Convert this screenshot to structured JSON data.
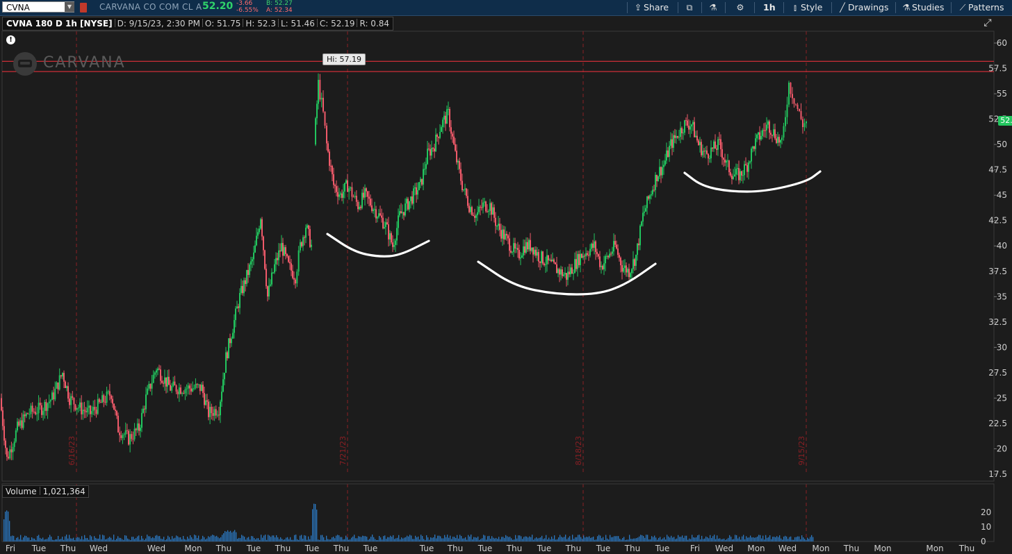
{
  "toolbar": {
    "symbol": "CVNA",
    "company": "CARVANA CO COM CL A",
    "last_price": "52.20",
    "net_change": "-3.66",
    "pct_change": "-6.55%",
    "bid": "B: 52.27",
    "ask": "A: 52.34",
    "share_label": "Share",
    "timeframe_label": "1h",
    "style_label": "Style",
    "drawings_label": "Drawings",
    "studies_label": "Studies",
    "patterns_label": "Patterns"
  },
  "chart_header": {
    "title": "CVNA 180 D 1h [NYSE]",
    "date": "D: 9/15/23, 2:30 PM",
    "open": "O: 51.75",
    "high": "H: 52.3",
    "low": "L: 51.46",
    "close": "C: 52.19",
    "range": "R: 0.84"
  },
  "logo_text": "CARVANA",
  "hi_label": "Hi: 57.19",
  "price_badge": "52.19",
  "volume_header": {
    "label": "Volume",
    "value": "1,021,364"
  },
  "colors": {
    "up": "#22c55e",
    "down": "#f05a6a",
    "resistance": "#e0303a",
    "annotation": "#ffffff",
    "background": "#1c1c1c"
  },
  "chart_data": {
    "type": "candlestick",
    "ylim": [
      17.5,
      60
    ],
    "y_ticks": [
      "60",
      "57.5",
      "55",
      "52.5",
      "50",
      "47.5",
      "45",
      "42.5",
      "40",
      "37.5",
      "35",
      "32.5",
      "30",
      "27.5",
      "25",
      "22.5",
      "20",
      "17.5"
    ],
    "x_tick_labels": [
      "Fri",
      "Tue",
      "Thu",
      "Wed",
      "Wed",
      "Mon",
      "Thu",
      "Tue",
      "Thu",
      "Tue",
      "Thu",
      "Tue",
      "Tue",
      "Thu",
      "Tue",
      "Thu",
      "Tue",
      "Thu",
      "Tue",
      "Thu",
      "Tue",
      "Fri",
      "Wed",
      "Mon",
      "Wed",
      "Mon",
      "Thu",
      "Mon",
      "Mon",
      "Thu"
    ],
    "period_markers": [
      "6/16/23",
      "7/21/23",
      "8/18/23",
      "9/15/23"
    ],
    "resistance_levels": [
      58.2,
      57.19
    ],
    "price_path": [
      [
        0,
        25
      ],
      [
        10,
        19
      ],
      [
        25,
        22
      ],
      [
        40,
        23.5
      ],
      [
        60,
        24
      ],
      [
        75,
        25
      ],
      [
        90,
        27.5
      ],
      [
        100,
        25
      ],
      [
        115,
        24
      ],
      [
        130,
        23.5
      ],
      [
        145,
        24.5
      ],
      [
        160,
        25.5
      ],
      [
        170,
        22
      ],
      [
        185,
        21
      ],
      [
        200,
        22
      ],
      [
        210,
        25
      ],
      [
        225,
        28
      ],
      [
        235,
        27
      ],
      [
        245,
        26
      ],
      [
        260,
        26
      ],
      [
        275,
        26
      ],
      [
        290,
        26
      ],
      [
        300,
        23.5
      ],
      [
        315,
        24
      ],
      [
        325,
        29
      ],
      [
        335,
        32
      ],
      [
        345,
        35
      ],
      [
        355,
        37
      ],
      [
        365,
        39
      ],
      [
        375,
        43
      ],
      [
        385,
        35
      ],
      [
        395,
        38
      ],
      [
        405,
        40
      ],
      [
        415,
        38
      ],
      [
        425,
        37
      ],
      [
        432,
        40
      ],
      [
        440,
        42
      ],
      [
        448,
        40
      ]
    ],
    "price_path_2": [
      [
        452,
        50
      ],
      [
        458,
        56
      ],
      [
        465,
        53
      ],
      [
        470,
        50
      ],
      [
        480,
        46
      ],
      [
        490,
        45
      ],
      [
        500,
        46
      ],
      [
        515,
        44
      ],
      [
        525,
        45
      ],
      [
        535,
        44
      ],
      [
        545,
        43
      ],
      [
        555,
        42
      ],
      [
        565,
        40
      ],
      [
        575,
        43
      ],
      [
        585,
        44
      ],
      [
        595,
        45
      ],
      [
        605,
        46
      ],
      [
        615,
        49
      ],
      [
        625,
        50
      ],
      [
        635,
        52
      ],
      [
        645,
        53
      ],
      [
        655,
        49
      ],
      [
        665,
        46
      ],
      [
        675,
        44
      ],
      [
        685,
        43
      ],
      [
        695,
        44
      ],
      [
        705,
        44
      ],
      [
        715,
        42
      ],
      [
        725,
        41
      ],
      [
        735,
        40
      ],
      [
        745,
        39
      ],
      [
        755,
        40
      ],
      [
        765,
        40
      ],
      [
        775,
        39
      ],
      [
        785,
        38.5
      ],
      [
        795,
        38
      ],
      [
        805,
        37.5
      ],
      [
        815,
        37
      ],
      [
        825,
        38
      ],
      [
        835,
        39
      ],
      [
        845,
        39.5
      ],
      [
        855,
        40
      ],
      [
        865,
        38
      ],
      [
        875,
        39
      ],
      [
        885,
        40
      ],
      [
        895,
        38
      ],
      [
        905,
        37.5
      ],
      [
        915,
        39
      ],
      [
        925,
        43
      ],
      [
        935,
        45
      ],
      [
        945,
        47
      ],
      [
        955,
        48
      ],
      [
        965,
        50
      ],
      [
        975,
        51
      ],
      [
        985,
        52
      ],
      [
        995,
        52
      ],
      [
        1005,
        50
      ],
      [
        1015,
        49
      ],
      [
        1025,
        49.5
      ],
      [
        1035,
        50
      ],
      [
        1045,
        48
      ],
      [
        1055,
        47
      ],
      [
        1065,
        47
      ],
      [
        1075,
        48
      ],
      [
        1085,
        50
      ],
      [
        1095,
        51
      ],
      [
        1105,
        52
      ],
      [
        1115,
        51
      ],
      [
        1125,
        50
      ],
      [
        1130,
        53
      ],
      [
        1135,
        56
      ],
      [
        1140,
        55
      ],
      [
        1145,
        54
      ],
      [
        1150,
        53
      ],
      [
        1155,
        52
      ],
      [
        1160,
        52.2
      ]
    ],
    "annotation_arcs": [
      [
        [
          471,
          337
        ],
        [
          510,
          363
        ],
        [
          545,
          370
        ],
        [
          575,
          368
        ],
        [
          617,
          347
        ]
      ],
      [
        [
          688,
          377
        ],
        [
          740,
          412
        ],
        [
          800,
          424
        ],
        [
          860,
          424
        ],
        [
          900,
          410
        ],
        [
          943,
          380
        ]
      ],
      [
        [
          985,
          249
        ],
        [
          1010,
          268
        ],
        [
          1050,
          276
        ],
        [
          1100,
          276
        ],
        [
          1160,
          262
        ],
        [
          1180,
          247
        ]
      ]
    ]
  }
}
